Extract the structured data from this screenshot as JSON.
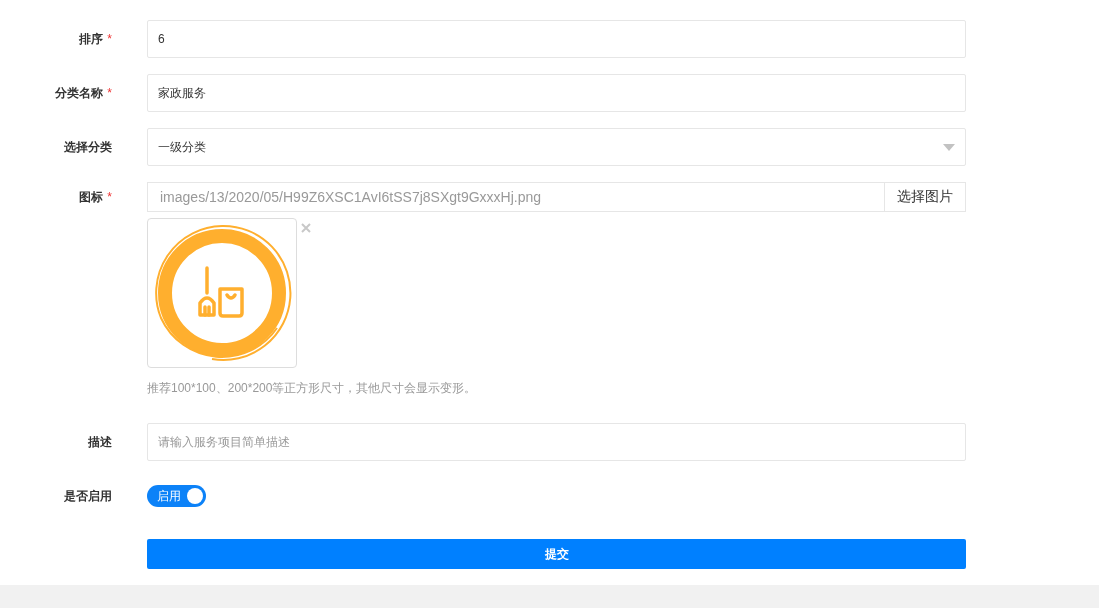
{
  "required_mark": "*",
  "fields": [
    {
      "kind": "input",
      "label": "排序",
      "required": true,
      "value": "6"
    },
    {
      "kind": "input",
      "label": "分类名称",
      "required": true,
      "value": "家政服务"
    },
    {
      "kind": "select",
      "label": "选择分类",
      "required": false,
      "value": "一级分类"
    },
    {
      "kind": "image",
      "label": "图标",
      "required": true,
      "value": "images/13/2020/05/H99Z6XSC1AvI6tSS7j8SXgt9GxxxHj.png",
      "button": "选择图片",
      "hint": "推荐100*100、200*200等正方形尺寸，其他尺寸会显示变形。"
    },
    {
      "kind": "input",
      "label": "描述",
      "required": false,
      "placeholder": "请输入服务项目简单描述"
    },
    {
      "kind": "switch",
      "label": "是否启用",
      "required": false,
      "on": true,
      "text": "启用"
    }
  ],
  "submit": "提交"
}
